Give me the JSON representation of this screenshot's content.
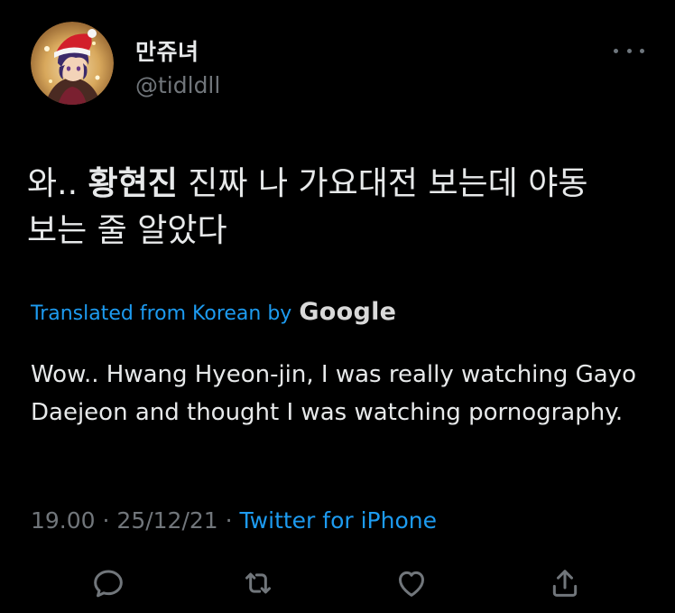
{
  "user": {
    "display_name": "만쥬녀",
    "handle": "@tidldll",
    "avatar_icon": "avatar-santa-hat"
  },
  "more_icon": "more-horizontal-icon",
  "tweet": {
    "text_before": "와.. ",
    "text_bold": "황현진",
    "text_after": " 진짜 나 가요대전 보는데 야동\n보는 줄 알았다",
    "translated_label": "Translated from Korean by",
    "translator_brand": "Google",
    "translation": "Wow.. Hwang Hyeon-jin, I was really watching Gayo Daejeon and thought I was watching pornography."
  },
  "meta": {
    "time": "19.00",
    "separator1": " · ",
    "date": "25/12/21",
    "separator2": " · ",
    "source": "Twitter for iPhone"
  },
  "actions": [
    "reply-icon",
    "retweet-icon",
    "like-icon",
    "share-icon"
  ],
  "colors": {
    "background": "#000000",
    "text": "#e7e9ea",
    "muted": "#71767b",
    "accent": "#1d9bf0"
  }
}
